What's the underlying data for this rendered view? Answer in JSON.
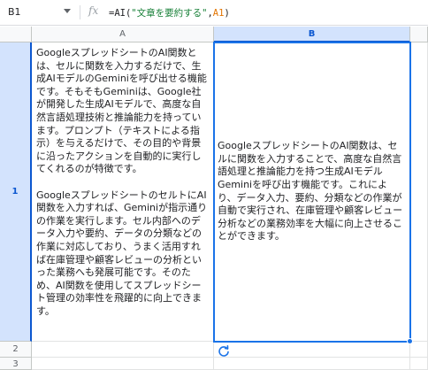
{
  "formula_bar": {
    "name_box": "B1",
    "fx": "fx",
    "formula_prefix": "=AI(",
    "formula_string": "\"文章を要約する\"",
    "formula_comma": ",",
    "formula_ref": "A1",
    "formula_suffix": ")"
  },
  "columns": [
    "A",
    "B"
  ],
  "rows": [
    "1",
    "2",
    "3"
  ],
  "cells": {
    "A1": [
      "GoogleスプレッドシートのAI関数とは、セルに関数を入力するだけで、生成AIモデルのGeminiを呼び出せる機能です。そもそもGeminiは、Google社が開発した生成AIモデルで、高度な自然言語処理技術と推論能力を持っています。プロンプト（テキストによる指示）を与えるだけで、その目的や背景に沿ったアクションを自動的に実行してくれるのが特徴です。",
      "GoogleスプレッドシートのセルトにAI関数を入力すれば、Geminiが指示通りの作業を実行します。セル内部へのデータ入力や要約、データの分類などの作業に対応しており、うまく活用すれば在庫管理や顧客レビューの分析といった業務へも発展可能です。そのため、AI関数を使用してスプレッドシート管理の効率性を飛躍的に向上できます。"
    ],
    "B1": "GoogleスプレッドシートのAI関数は、セルに関数を入力することで、高度な自然言語処理と推論能力を持つ生成AIモデルGeminiを呼び出す機能です。これにより、データ入力、要約、分類などの作業が自動で実行され、在庫管理や顧客レビュー分析などの業務効率を大幅に向上させることができます。"
  },
  "colors": {
    "selection": "#1a73e8",
    "header_selected_bg": "#d3e3fd",
    "header_selected_text": "#0b57d0",
    "formula_string": "#188038",
    "formula_ref": "#e37400"
  },
  "icons": {
    "refresh": "refresh-icon",
    "dropdown": "chevron-down-icon",
    "function": "fx-icon"
  }
}
